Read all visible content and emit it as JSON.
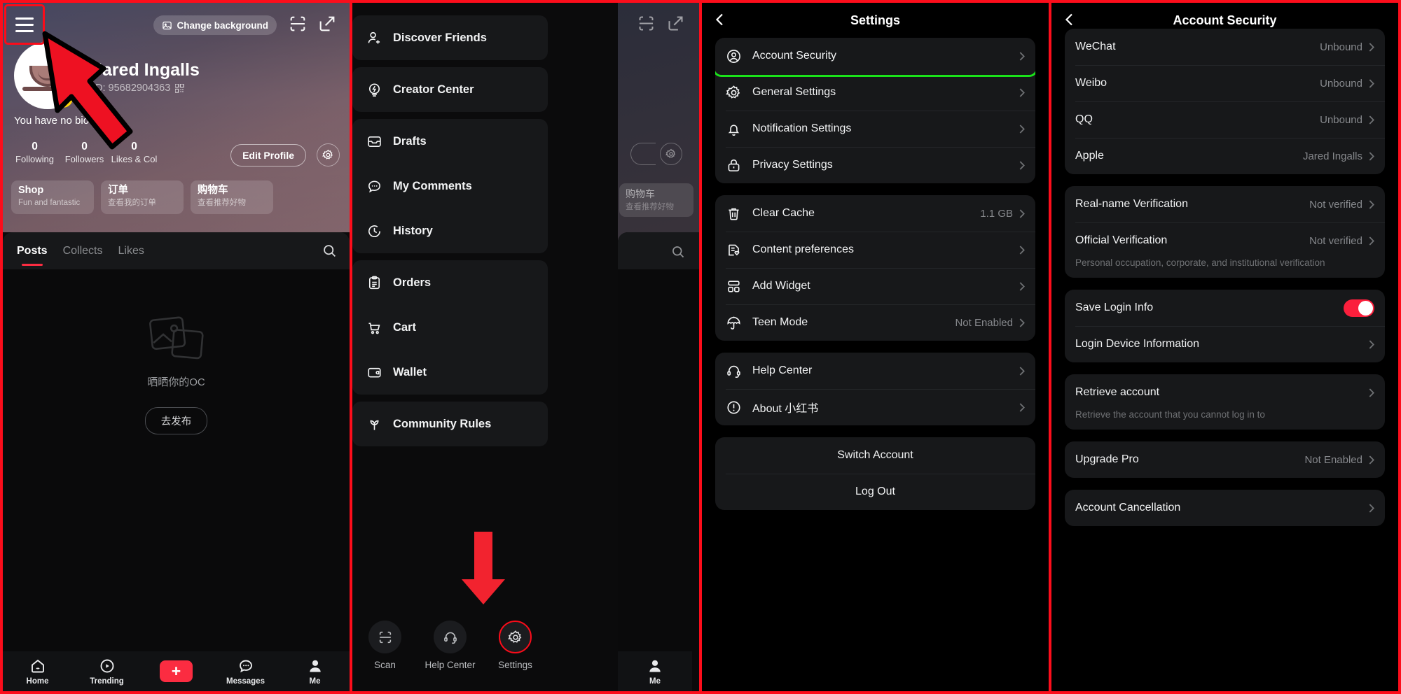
{
  "panel1": {
    "name": "profile-screen",
    "hamburger_icon": "hamburger-menu-icon",
    "change_background": "Change background",
    "scan_icon": "scan-icon",
    "share_icon": "share-external-icon",
    "user_name": "Jared Ingalls",
    "user_id_label": "ID: 95682904363",
    "qr_icon": "qr-code-icon",
    "bio": "You have no bio yet",
    "stats": [
      {
        "value": "0",
        "label": "Following"
      },
      {
        "value": "0",
        "label": "Followers"
      },
      {
        "value": "0",
        "label": "Likes & Col"
      }
    ],
    "edit_profile": "Edit Profile",
    "gear_icon": "gear-icon",
    "cards": [
      {
        "title": "Shop",
        "subtitle": "Fun and fantastic"
      },
      {
        "title": "订单",
        "subtitle": "查看我的订单"
      },
      {
        "title": "购物车",
        "subtitle": "查看推荐好物"
      }
    ],
    "tabs": [
      {
        "label": "Posts",
        "active": true
      },
      {
        "label": "Collects",
        "active": false
      },
      {
        "label": "Likes",
        "active": false
      }
    ],
    "search_icon": "search-icon",
    "empty_caption": "晒晒你的OC",
    "empty_button": "去发布",
    "tabbar": [
      {
        "label": "Home",
        "icon": "home-icon"
      },
      {
        "label": "Trending",
        "icon": "play-circle-icon"
      },
      {
        "label": "",
        "icon": "plus-icon"
      },
      {
        "label": "Messages",
        "icon": "chat-bubble-icon"
      },
      {
        "label": "Me",
        "icon": "person-icon"
      }
    ]
  },
  "panel2": {
    "name": "side-drawer-screen",
    "groups": [
      {
        "items": [
          {
            "label": "Discover Friends",
            "icon": "person-add-icon"
          }
        ]
      },
      {
        "items": [
          {
            "label": "Creator Center",
            "icon": "lightbulb-icon"
          }
        ]
      },
      {
        "items": [
          {
            "label": "Drafts",
            "icon": "inbox-icon"
          },
          {
            "label": "My Comments",
            "icon": "comment-icon"
          },
          {
            "label": "History",
            "icon": "clock-icon"
          }
        ]
      },
      {
        "items": [
          {
            "label": "Orders",
            "icon": "clipboard-icon"
          },
          {
            "label": "Cart",
            "icon": "cart-icon"
          },
          {
            "label": "Wallet",
            "icon": "wallet-icon"
          }
        ]
      },
      {
        "items": [
          {
            "label": "Community Rules",
            "icon": "sprout-icon"
          }
        ]
      }
    ],
    "bottom": [
      {
        "label": "Scan",
        "icon": "scan-icon",
        "selected": false
      },
      {
        "label": "Help Center",
        "icon": "headset-icon",
        "selected": false
      },
      {
        "label": "Settings",
        "icon": "gear-icon",
        "selected": true
      }
    ],
    "underlay_me_label": "Me"
  },
  "panel3": {
    "name": "settings-screen",
    "title": "Settings",
    "back_icon": "chevron-left-icon",
    "groups": [
      {
        "items": [
          {
            "label": "Account Security",
            "icon": "user-circle-icon",
            "value": "",
            "highlight": true
          },
          {
            "label": "General Settings",
            "icon": "gear-icon",
            "value": ""
          },
          {
            "label": "Notification Settings",
            "icon": "bell-icon",
            "value": ""
          },
          {
            "label": "Privacy Settings",
            "icon": "lock-icon",
            "value": ""
          }
        ]
      },
      {
        "items": [
          {
            "label": "Clear Cache",
            "icon": "trash-icon",
            "value": "1.1 GB"
          },
          {
            "label": "Content preferences",
            "icon": "document-heart-icon",
            "value": ""
          },
          {
            "label": "Add Widget",
            "icon": "widget-icon",
            "value": ""
          },
          {
            "label": "Teen Mode",
            "icon": "umbrella-icon",
            "value": "Not Enabled"
          }
        ]
      },
      {
        "items": [
          {
            "label": "Help Center",
            "icon": "headset-icon",
            "value": ""
          },
          {
            "label": "About 小红书",
            "icon": "info-circle-icon",
            "value": ""
          }
        ]
      }
    ],
    "actions": [
      {
        "label": "Switch Account"
      },
      {
        "label": "Log Out"
      }
    ]
  },
  "panel4": {
    "name": "account-security-screen",
    "title": "Account Security",
    "back_icon": "chevron-left-icon",
    "groups": [
      {
        "items": [
          {
            "label": "WeChat",
            "value": "Unbound"
          },
          {
            "label": "Weibo",
            "value": "Unbound"
          },
          {
            "label": "QQ",
            "value": "Unbound"
          },
          {
            "label": "Apple",
            "value": "Jared Ingalls"
          }
        ]
      },
      {
        "items": [
          {
            "label": "Real-name Verification",
            "value": "Not verified"
          },
          {
            "label": "Official Verification",
            "value": "Not verified",
            "sub": "Personal occupation, corporate, and institutional verification"
          }
        ]
      },
      {
        "items": [
          {
            "label": "Save Login Info",
            "toggle": true,
            "toggle_on": true
          },
          {
            "label": "Login Device Information",
            "value": ""
          }
        ]
      },
      {
        "items": [
          {
            "label": "Retrieve account",
            "value": "",
            "sub": "Retrieve the account that you cannot log in to"
          }
        ]
      },
      {
        "items": [
          {
            "label": "Upgrade Pro",
            "value": "Not Enabled"
          }
        ]
      },
      {
        "items": [
          {
            "label": "Account Cancellation",
            "value": "",
            "highlight": true
          }
        ]
      }
    ]
  },
  "colors": {
    "brand_red": "#fb2c41",
    "frame_red": "#fc0d1b",
    "highlight_green": "#1ae21a",
    "card_bg": "#17181a",
    "page_bg": "#0b0b0c"
  }
}
